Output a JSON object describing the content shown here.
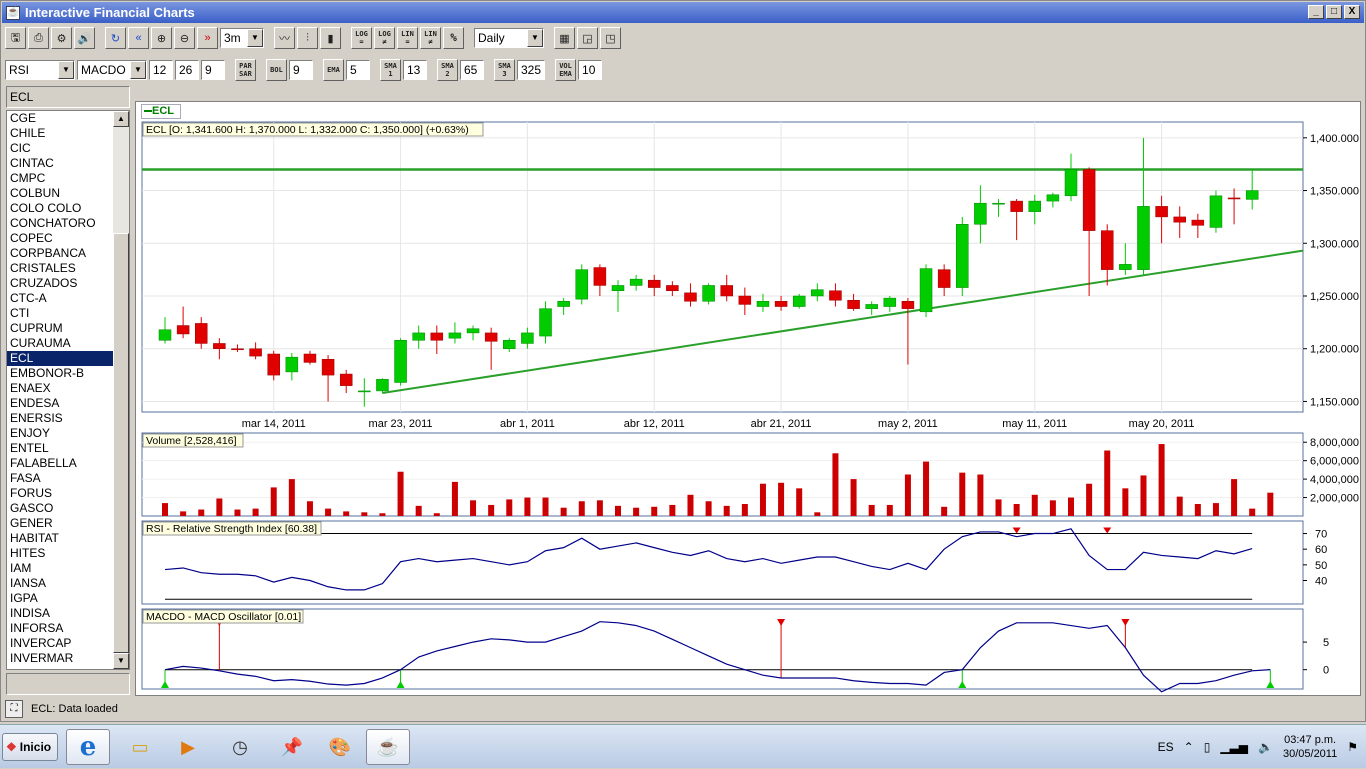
{
  "window": {
    "title": "Interactive Financial Charts",
    "minimize": "_",
    "maximize": "□",
    "close": "X"
  },
  "toolbar1": {
    "buttons": [
      "save-icon",
      "print-icon",
      "settings-icon",
      "sound-icon",
      "refresh-icon",
      "rewind-icon",
      "zoom-in-icon",
      "zoom-out-icon",
      "forward-icon"
    ],
    "range_select": "3m",
    "chart_type_buttons": [
      "line-chart-icon",
      "bar-chart-icon",
      "candlestick-icon"
    ],
    "scale_buttons": [
      [
        "LOG",
        "="
      ],
      [
        "LOG",
        "≠"
      ],
      [
        "LIN",
        "="
      ],
      [
        "LIN",
        "≠"
      ],
      [
        "%",
        ""
      ]
    ],
    "period_select": "Daily",
    "view_buttons": [
      "palette-icon",
      "overlay-chart-icon",
      "window-chart-icon"
    ]
  },
  "toolbar2": {
    "indicator1": "RSI",
    "indicator2": "MACDO",
    "macd_params": [
      "12",
      "26",
      "9"
    ],
    "par_sar": [
      "PAR",
      "SAR"
    ],
    "bol": "BOL",
    "bol_val": "9",
    "ema": "EMA",
    "ema_val": "5",
    "sma1": [
      "SMA",
      "1"
    ],
    "sma1_val": "13",
    "sma2": [
      "SMA",
      "2"
    ],
    "sma2_val": "65",
    "sma3": [
      "SMA",
      "3"
    ],
    "sma3_val": "325",
    "volema": [
      "VOL",
      "EMA"
    ],
    "volema_val": "10"
  },
  "sidebar": {
    "symbol_input": "ECL",
    "items": [
      "CGE",
      "CHILE",
      "CIC",
      "CINTAC",
      "CMPC",
      "COLBUN",
      "COLO COLO",
      "CONCHATORO",
      "COPEC",
      "CORPBANCA",
      "CRISTALES",
      "CRUZADOS",
      "CTC-A",
      "CTI",
      "CUPRUM",
      "CURAUMA",
      "ECL",
      "EMBONOR-B",
      "ENAEX",
      "ENDESA",
      "ENERSIS",
      "ENJOY",
      "ENTEL",
      "FALABELLA",
      "FASA",
      "FORUS",
      "GASCO",
      "GENER",
      "HABITAT",
      "HITES",
      "IAM",
      "IANSA",
      "IGPA",
      "INDISA",
      "INFORSA",
      "INVERCAP",
      "INVERMAR"
    ],
    "selected": "ECL"
  },
  "legend": {
    "symbol": "ECL"
  },
  "status": {
    "text": "ECL: Data loaded"
  },
  "taskbar": {
    "start": "Inicio",
    "lang": "ES",
    "time": "03:47 p.m.",
    "date": "30/05/2011"
  },
  "colors": {
    "up": "#00cc00",
    "down": "#e00000",
    "line": "#2aa02a",
    "volume": "#cc0000",
    "indicator": "#00008b"
  },
  "chart_data": [
    {
      "type": "candlestick",
      "title": "ECL [O: 1,341.600  H: 1,370.000  L: 1,332.000  C: 1,350.000] (+0.63%)",
      "ylim": [
        1140000,
        1415000
      ],
      "yticks": [
        1150000,
        1200000,
        1250000,
        1300000,
        1350000,
        1400000
      ],
      "ytick_labels": [
        "1,150.000",
        "1,200.000",
        "1,250.000",
        "1,300.000",
        "1,350.000",
        "1,400.000"
      ],
      "xtick_labels": [
        "mar 14, 2011",
        "mar 23, 2011",
        "abr 1, 2011",
        "abr 12, 2011",
        "abr 21, 2011",
        "may 2, 2011",
        "may 11, 2011",
        "may 20, 2011"
      ],
      "xtick_index": [
        6,
        13,
        20,
        27,
        34,
        41,
        48,
        55
      ],
      "resistance": 1370000,
      "trendline": [
        [
          12,
          1158000
        ],
        [
          63,
          1293000
        ]
      ],
      "ohlc": [
        [
          1208,
          1230,
          1205,
          1218
        ],
        [
          1222,
          1240,
          1210,
          1214
        ],
        [
          1224,
          1230,
          1200,
          1205
        ],
        [
          1205,
          1210,
          1190,
          1200
        ],
        [
          1200,
          1204,
          1197,
          1199
        ],
        [
          1200,
          1206,
          1190,
          1193
        ],
        [
          1195,
          1198,
          1170,
          1175
        ],
        [
          1178,
          1196,
          1170,
          1192
        ],
        [
          1195,
          1198,
          1185,
          1187
        ],
        [
          1190,
          1194,
          1150,
          1175
        ],
        [
          1176,
          1180,
          1158,
          1165
        ],
        [
          1160,
          1172,
          1145,
          1160
        ],
        [
          1160,
          1172,
          1158,
          1171
        ],
        [
          1168,
          1210,
          1165,
          1208
        ],
        [
          1208,
          1222,
          1200,
          1215
        ],
        [
          1215,
          1222,
          1195,
          1208
        ],
        [
          1210,
          1225,
          1205,
          1215
        ],
        [
          1215,
          1222,
          1208,
          1219
        ],
        [
          1215,
          1220,
          1180,
          1207
        ],
        [
          1200,
          1210,
          1197,
          1208
        ],
        [
          1205,
          1220,
          1200,
          1215
        ],
        [
          1212,
          1245,
          1205,
          1238
        ],
        [
          1240,
          1248,
          1232,
          1245
        ],
        [
          1247,
          1280,
          1242,
          1275
        ],
        [
          1277,
          1280,
          1250,
          1260
        ],
        [
          1255,
          1265,
          1235,
          1260
        ],
        [
          1260,
          1270,
          1255,
          1266
        ],
        [
          1265,
          1270,
          1250,
          1258
        ],
        [
          1260,
          1264,
          1250,
          1255
        ],
        [
          1253,
          1262,
          1240,
          1245
        ],
        [
          1245,
          1262,
          1242,
          1260
        ],
        [
          1260,
          1270,
          1245,
          1250
        ],
        [
          1250,
          1258,
          1232,
          1242
        ],
        [
          1240,
          1252,
          1235,
          1245
        ],
        [
          1245,
          1250,
          1236,
          1240
        ],
        [
          1240,
          1252,
          1238,
          1250
        ],
        [
          1250,
          1262,
          1245,
          1256
        ],
        [
          1255,
          1262,
          1240,
          1246
        ],
        [
          1246,
          1252,
          1236,
          1238
        ],
        [
          1238,
          1245,
          1232,
          1242
        ],
        [
          1240,
          1250,
          1235,
          1248
        ],
        [
          1245,
          1248,
          1185,
          1238
        ],
        [
          1235,
          1280,
          1230,
          1276
        ],
        [
          1275,
          1280,
          1250,
          1258
        ],
        [
          1258,
          1325,
          1250,
          1318
        ],
        [
          1318,
          1355,
          1300,
          1338
        ],
        [
          1338,
          1342,
          1325,
          1338
        ],
        [
          1340,
          1342,
          1303,
          1330
        ],
        [
          1330,
          1346,
          1318,
          1340
        ],
        [
          1340,
          1348,
          1334,
          1346
        ],
        [
          1345,
          1385,
          1340,
          1370
        ],
        [
          1370,
          1372,
          1250,
          1312
        ],
        [
          1312,
          1318,
          1260,
          1275
        ],
        [
          1275,
          1300,
          1270,
          1280
        ],
        [
          1275,
          1400,
          1270,
          1335
        ],
        [
          1335,
          1345,
          1300,
          1325
        ],
        [
          1325,
          1335,
          1305,
          1320
        ],
        [
          1322,
          1328,
          1305,
          1317
        ],
        [
          1315,
          1350,
          1310,
          1345
        ],
        [
          1343,
          1352,
          1318,
          1342
        ],
        [
          1341.6,
          1370,
          1332,
          1350
        ]
      ]
    },
    {
      "type": "bar",
      "title": "Volume [2,528,416]",
      "ylim": [
        0,
        9000000
      ],
      "yticks": [
        2000000,
        4000000,
        6000000,
        8000000
      ],
      "ytick_labels": [
        "2,000,000",
        "4,000,000",
        "6,000,000",
        "8,000,000"
      ],
      "values": [
        1400000,
        500000,
        700000,
        1900000,
        700000,
        800000,
        3100000,
        4000000,
        1600000,
        800000,
        500000,
        400000,
        300000,
        4800000,
        1100000,
        300000,
        3700000,
        1700000,
        1200000,
        1800000,
        2000000,
        2000000,
        900000,
        1600000,
        1700000,
        1100000,
        900000,
        1000000,
        1200000,
        2300000,
        1600000,
        1100000,
        1300000,
        3500000,
        3600000,
        3000000,
        400000,
        6800000,
        4000000,
        1200000,
        1200000,
        4500000,
        5900000,
        1000000,
        4700000,
        4500000,
        1800000,
        1300000,
        2300000,
        1700000,
        2000000,
        3500000,
        7100000,
        3000000,
        4400000,
        7800000,
        2100000,
        1300000,
        1400000,
        4000000,
        800000,
        2528416
      ]
    },
    {
      "type": "line",
      "title": "RSI - Relative Strength Index [60.38]",
      "ylim": [
        25,
        78
      ],
      "yticks": [
        40,
        50,
        60,
        70
      ],
      "ytick_labels": [
        "40",
        "50",
        "60",
        "70"
      ],
      "hlines": [
        70,
        28
      ],
      "values": [
        47,
        48,
        45,
        44,
        44,
        43,
        39,
        42,
        40,
        36,
        34,
        34,
        38,
        52,
        54,
        52,
        53,
        54,
        52,
        50,
        52,
        59,
        61,
        67,
        60,
        62,
        64,
        61,
        58,
        56,
        59,
        54,
        52,
        54,
        51,
        53,
        55,
        55,
        52,
        49,
        47,
        51,
        47,
        60,
        68,
        71,
        71,
        68,
        70,
        70,
        73,
        56,
        47,
        47,
        58,
        56,
        55,
        54,
        59,
        57,
        60.38
      ],
      "markers": [
        {
          "i": 47,
          "v": 70
        },
        {
          "i": 52,
          "v": 70
        }
      ]
    },
    {
      "type": "line",
      "title": "MACDO - MACD Oscillator [0.01]",
      "ylim": [
        -3.5,
        11
      ],
      "yticks": [
        0,
        5
      ],
      "ytick_labels": [
        "0",
        "5"
      ],
      "values": [
        0,
        0.6,
        0.3,
        -0.2,
        -0.8,
        -1.2,
        -2,
        -1.8,
        -2.1,
        -2.6,
        -2.8,
        -2.5,
        -1.5,
        0,
        2.3,
        3.4,
        4.2,
        5,
        5.6,
        5.4,
        5,
        5,
        6,
        7,
        8.7,
        8.5,
        8,
        7,
        5.5,
        4,
        2.5,
        1,
        0,
        -1,
        -1.5,
        -1.5,
        -1.5,
        -1.5,
        -2,
        -2.3,
        -2.5,
        -2.5,
        -2.8,
        -0.5,
        0,
        4,
        7,
        8.5,
        8.5,
        8.5,
        8,
        7.5,
        8,
        4,
        -1,
        -4,
        -2.5,
        -2.5,
        -2,
        -1,
        -0.2,
        0.01
      ],
      "sell_markers": [
        3,
        34,
        53
      ],
      "buy_markers": [
        0,
        13,
        44,
        61
      ]
    }
  ]
}
